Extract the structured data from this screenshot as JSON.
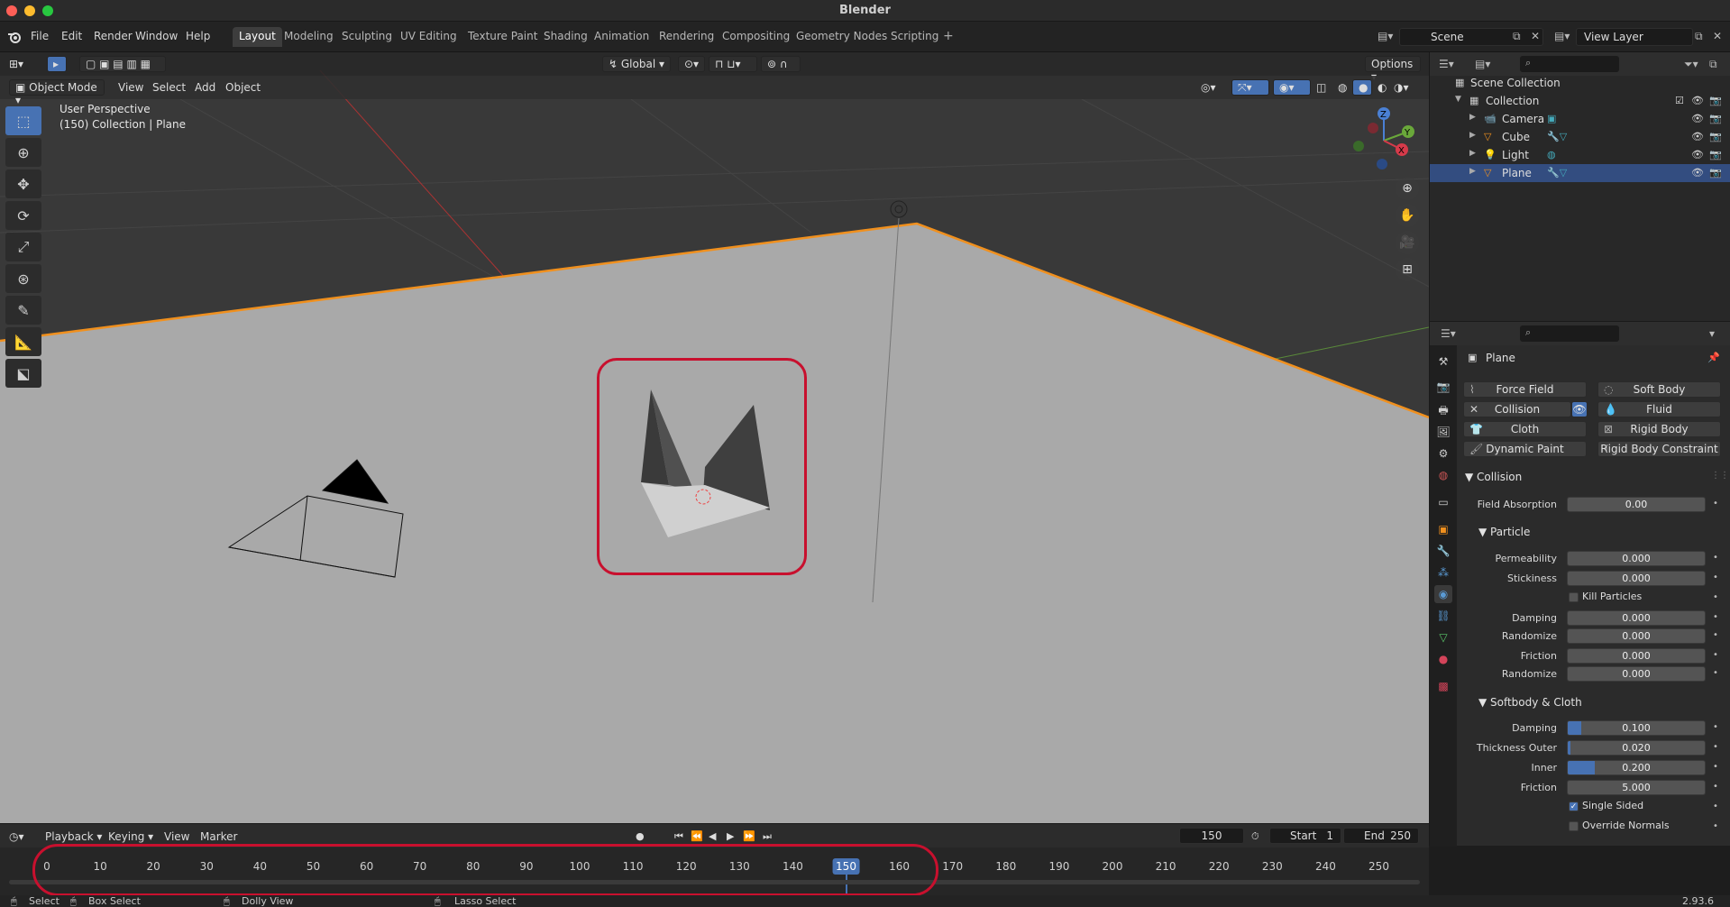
{
  "window": {
    "title": "Blender"
  },
  "menu": {
    "file": "File",
    "edit": "Edit",
    "render": "Render",
    "window": "Window",
    "help": "Help"
  },
  "workspace_tabs": [
    {
      "label": "Layout",
      "active": true
    },
    {
      "label": "Modeling"
    },
    {
      "label": "Sculpting"
    },
    {
      "label": "UV Editing"
    },
    {
      "label": "Texture Paint"
    },
    {
      "label": "Shading"
    },
    {
      "label": "Animation"
    },
    {
      "label": "Rendering"
    },
    {
      "label": "Compositing"
    },
    {
      "label": "Geometry Nodes"
    },
    {
      "label": "Scripting"
    }
  ],
  "scene": {
    "name": "Scene",
    "view_layer": "View Layer"
  },
  "viewport": {
    "mode": "Object Mode",
    "menus": [
      "View",
      "Select",
      "Add",
      "Object"
    ],
    "transform_orientation": "Global",
    "options_label": "Options",
    "perspective": "User Perspective",
    "context": "(150) Collection | Plane"
  },
  "outliner": {
    "scene_collection": "Scene Collection",
    "collection": "Collection",
    "items": [
      {
        "name": "Camera"
      },
      {
        "name": "Cube"
      },
      {
        "name": "Light"
      },
      {
        "name": "Plane",
        "selected": true
      }
    ]
  },
  "properties": {
    "object_name": "Plane",
    "physics_buttons": [
      {
        "label": "Force Field"
      },
      {
        "label": "Soft Body"
      },
      {
        "label": "Collision",
        "enabled": true
      },
      {
        "label": "Fluid"
      },
      {
        "label": "Cloth"
      },
      {
        "label": "Rigid Body"
      },
      {
        "label": "Dynamic Paint"
      },
      {
        "label": "Rigid Body Constraint"
      }
    ],
    "collision_panel": "Collision",
    "field_absorption": {
      "label": "Field Absorption",
      "value": "0.00"
    },
    "particle_panel": "Particle",
    "permeability": {
      "label": "Permeability",
      "value": "0.000"
    },
    "stickiness": {
      "label": "Stickiness",
      "value": "0.000"
    },
    "kill_particles": "Kill Particles",
    "damping": {
      "label": "Damping",
      "value": "0.000"
    },
    "damping_randomize": {
      "label": "Randomize",
      "value": "0.000"
    },
    "friction": {
      "label": "Friction",
      "value": "0.000"
    },
    "friction_randomize": {
      "label": "Randomize",
      "value": "0.000"
    },
    "softbody_panel": "Softbody & Cloth",
    "sb_damping": {
      "label": "Damping",
      "value": "0.100",
      "fill": 0.1
    },
    "thickness_outer": {
      "label": "Thickness Outer",
      "value": "0.020",
      "fill": 0.02
    },
    "inner": {
      "label": "Inner",
      "value": "0.200",
      "fill": 0.2
    },
    "sb_friction": {
      "label": "Friction",
      "value": "5.000",
      "fill": 0.0
    },
    "single_sided": "Single Sided",
    "override_normals": "Override Normals"
  },
  "timeline": {
    "menus": [
      "Playback",
      "Keying",
      "View",
      "Marker"
    ],
    "current_frame": "150",
    "start_label": "Start",
    "start": "1",
    "end_label": "End",
    "end": "250",
    "ticks": [
      "0",
      "10",
      "20",
      "30",
      "40",
      "50",
      "60",
      "70",
      "80",
      "90",
      "100",
      "110",
      "120",
      "130",
      "140",
      "150",
      "160",
      "170",
      "180",
      "190",
      "200",
      "210",
      "220",
      "230",
      "240",
      "250"
    ]
  },
  "status": {
    "select": "Select",
    "box_select": "Box Select",
    "dolly_view": "Dolly View",
    "lasso_select": "Lasso Select",
    "version": "2.93.6"
  },
  "colors": {
    "accent": "#4772b3",
    "highlight": "#c8102e",
    "selection_outline": "#f0901e"
  }
}
